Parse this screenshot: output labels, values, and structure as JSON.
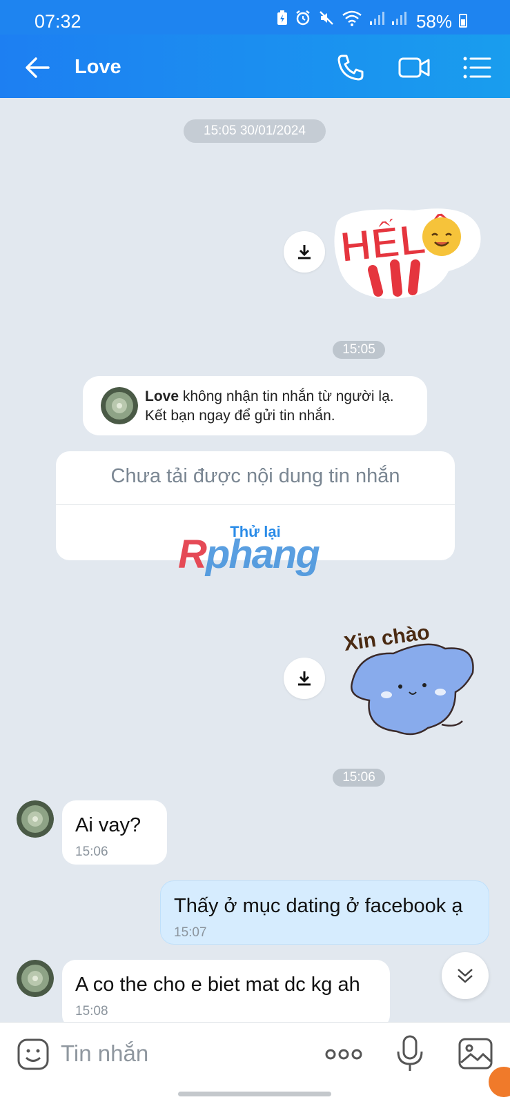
{
  "status_bar": {
    "time": "07:32",
    "battery": "58%"
  },
  "header": {
    "title": "Love"
  },
  "chat": {
    "date_chip": "15:05 30/01/2024",
    "sticker1": {
      "text": "HẾLÔ"
    },
    "time1": "15:05",
    "notice": {
      "name": "Love",
      "text_line1": " không nhận tin nhắn từ người lạ.",
      "text_line2": "Kết bạn ngay để gửi tin nhắn."
    },
    "failed_card": {
      "title": "Chưa tải được nội dung tin nhắn",
      "retry": "Thử lại"
    },
    "watermark": {
      "first": "R",
      "rest": "phang"
    },
    "sticker2": {
      "text": "Xin chào"
    },
    "time2": "15:06",
    "messages": [
      {
        "direction": "in",
        "text": "Ai vay?",
        "time": "15:06"
      },
      {
        "direction": "out",
        "text": "Thấy ở mục dating ở facebook ạ",
        "time": "15:07"
      },
      {
        "direction": "in",
        "text": "A co the cho e biet mat dc kg ah",
        "time": "15:08"
      }
    ]
  },
  "composer": {
    "placeholder": "Tin nhắn"
  },
  "colors": {
    "header": "#1d7ff2",
    "background": "#e2e8ef",
    "outgoing_bubble": "#d6ecfe",
    "retry_link": "#2b8ce8"
  },
  "icons": {
    "back": "back-arrow-icon",
    "call": "phone-icon",
    "video": "video-camera-icon",
    "menu": "list-menu-icon",
    "download": "download-icon",
    "scroll": "chevron-double-down-icon",
    "emoji": "emoji-icon",
    "more": "more-dots-icon",
    "mic": "microphone-icon",
    "image": "image-icon"
  }
}
